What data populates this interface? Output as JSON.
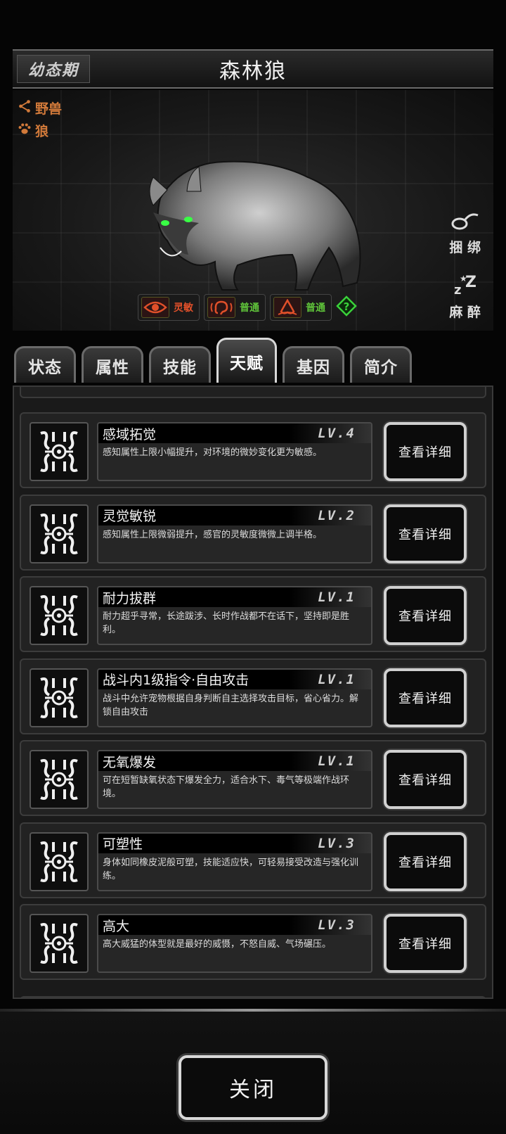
{
  "header": {
    "stage": "幼态期",
    "title": "森林狼"
  },
  "creature": {
    "tags": [
      {
        "icon": "share-icon",
        "label": "野兽"
      },
      {
        "icon": "paw-icon",
        "label": "狼"
      }
    ],
    "actions": [
      {
        "icon": "rope-icon",
        "label": "捆 绑"
      },
      {
        "icon": "sleep-icon",
        "label": "麻 醉"
      }
    ],
    "senses": [
      {
        "icon": "eye-icon",
        "label": "灵敏"
      },
      {
        "icon": "ear-icon",
        "label": "普通"
      },
      {
        "icon": "nose-icon",
        "label": "普通"
      }
    ],
    "help_icon": "question-icon"
  },
  "tabs": [
    {
      "label": "状态",
      "active": false
    },
    {
      "label": "属性",
      "active": false
    },
    {
      "label": "技能",
      "active": false
    },
    {
      "label": "天赋",
      "active": true
    },
    {
      "label": "基因",
      "active": false
    },
    {
      "label": "简介",
      "active": false
    }
  ],
  "talents": [
    {
      "name": "感域拓觉",
      "level": "LV.4",
      "desc": "感知属性上限小幅提升，对环境的微妙变化更为敏感。",
      "button": "查看详细"
    },
    {
      "name": "灵觉敏锐",
      "level": "LV.2",
      "desc": "感知属性上限微弱提升，感官的灵敏度微微上调半格。",
      "button": "查看详细"
    },
    {
      "name": "耐力拔群",
      "level": "LV.1",
      "desc": "耐力超乎寻常，长途跋涉、长时作战都不在话下，坚持即是胜利。",
      "button": "查看详细"
    },
    {
      "name": "战斗内1级指令·自由攻击",
      "level": "LV.1",
      "desc": "战斗中允许宠物根据自身判断自主选择攻击目标，省心省力。解锁自由攻击",
      "button": "查看详细"
    },
    {
      "name": "无氧爆发",
      "level": "LV.1",
      "desc": "可在短暂缺氧状态下爆发全力，适合水下、毒气等极端作战环境。",
      "button": "查看详细"
    },
    {
      "name": "可塑性",
      "level": "LV.3",
      "desc": "身体如同橡皮泥般可塑，技能适应快，可轻易接受改造与强化训练。",
      "button": "查看详细"
    },
    {
      "name": "高大",
      "level": "LV.3",
      "desc": "高大威猛的体型就是最好的威慑，不怒自威、气场碾压。",
      "button": "查看详细"
    }
  ],
  "footer": {
    "close_label": "关闭"
  }
}
